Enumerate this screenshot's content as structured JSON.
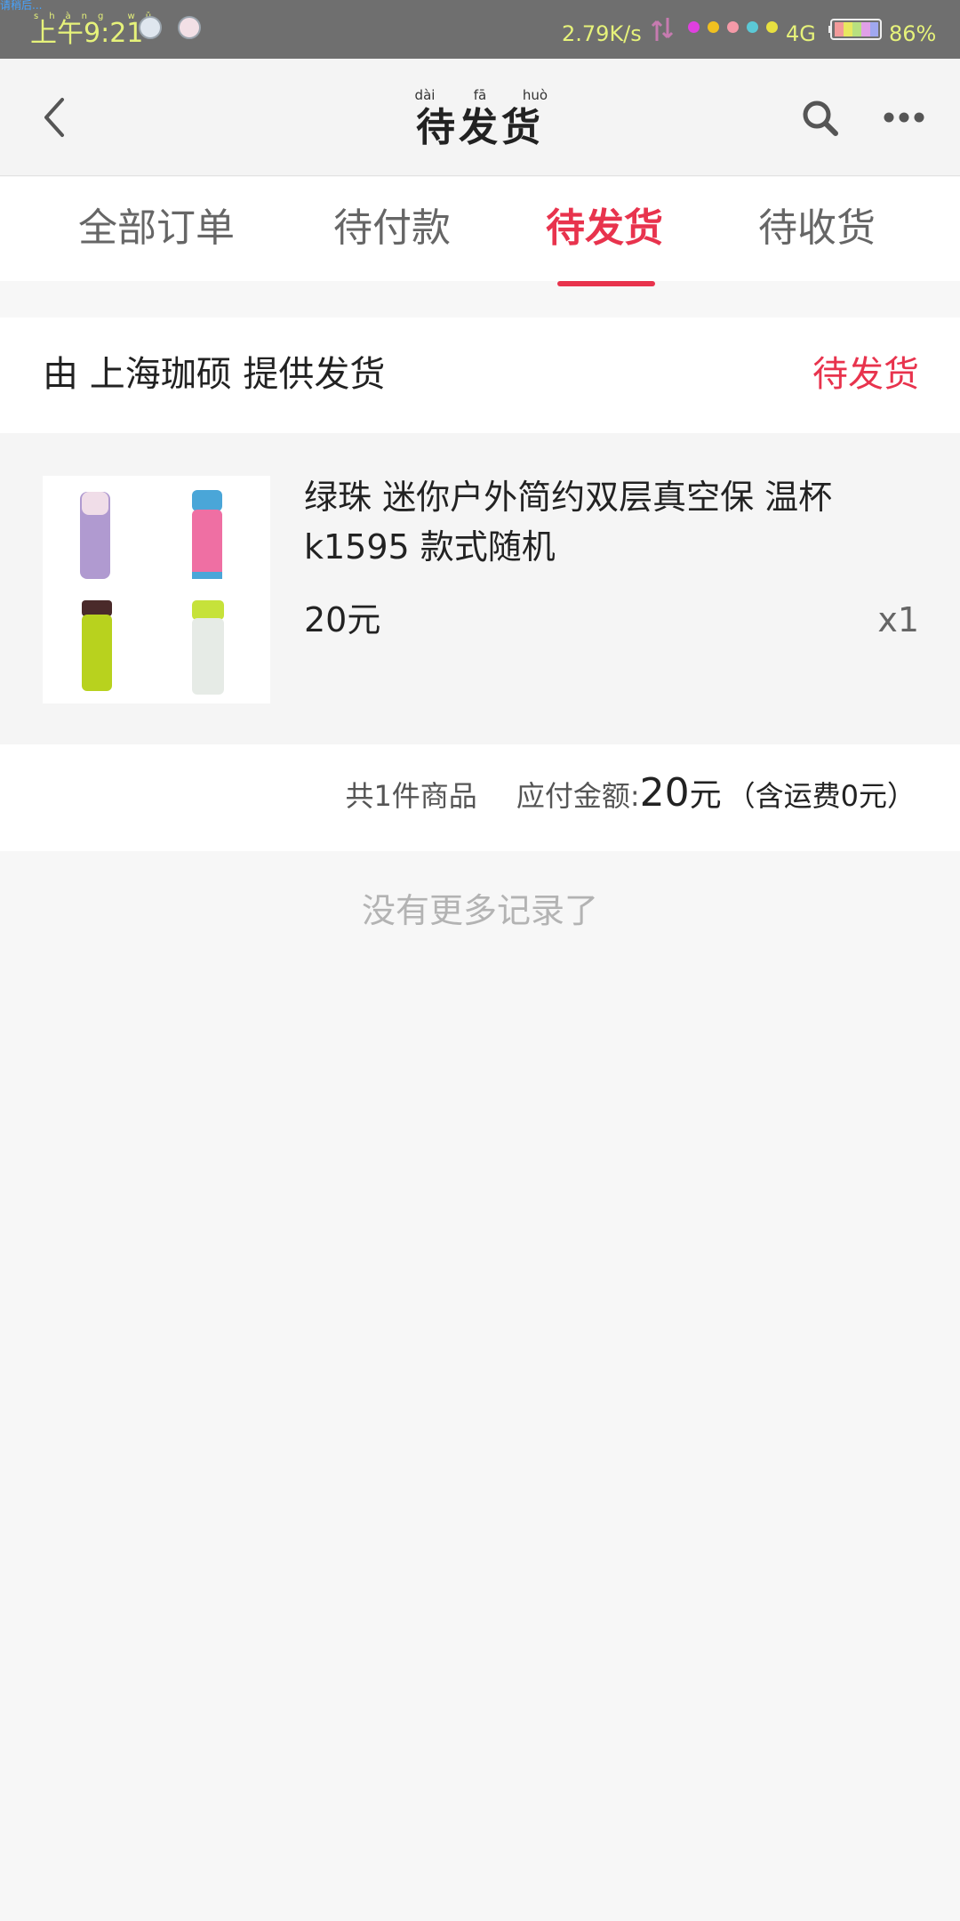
{
  "status_bar": {
    "tiny_text": "请稍后...",
    "time_pinyin": "shàng wǔ",
    "time": "上午9:21",
    "net_speed": "2.79K/s",
    "network": "4G",
    "battery": "86%",
    "dot_colors": [
      "#e040e0",
      "#f0c020",
      "#f59aa8",
      "#5bc9d6",
      "#e8e040"
    ]
  },
  "header": {
    "title": "待发货",
    "title_pinyin": [
      "dài",
      "fā",
      "huò"
    ]
  },
  "tabs": [
    {
      "label": "全部订单",
      "active": false
    },
    {
      "label": "待付款",
      "active": false
    },
    {
      "label": "待发货",
      "active": true
    },
    {
      "label": "待收货",
      "active": false
    }
  ],
  "order": {
    "shop_label": "由 上海珈硕 提供发货",
    "status": "待发货",
    "product": {
      "title": "绿珠 迷你户外简约双层真空保 温杯 k1595 款式随机",
      "price": "20元",
      "quantity": "x1"
    },
    "summary": {
      "count": "共1件商品",
      "amount_label": "应付金额:",
      "amount": "20",
      "amount_unit": "元",
      "shipping": "（含运费0元）"
    }
  },
  "footer": {
    "no_more": "没有更多记录了"
  },
  "colors": {
    "accent": "#e8334d",
    "status_bar_bg": "#6f6f6f",
    "status_text": "#e6f27a"
  }
}
